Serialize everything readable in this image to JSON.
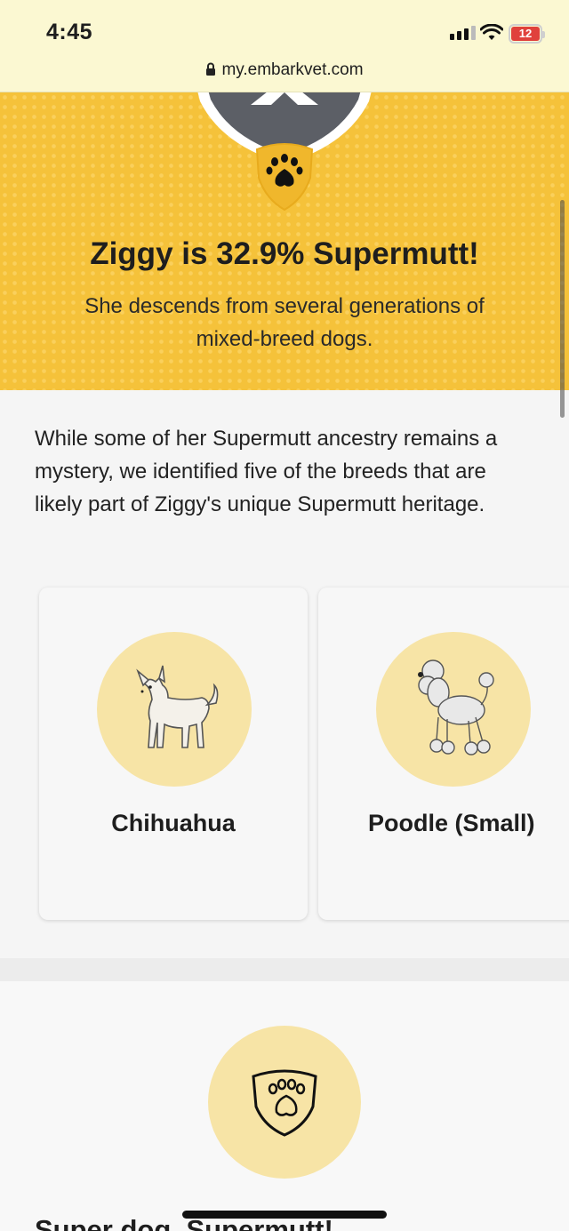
{
  "status_bar": {
    "time": "4:45",
    "battery": "12"
  },
  "browser": {
    "url": "my.embarkvet.com"
  },
  "hero": {
    "title": "Ziggy is 32.9% Supermutt!",
    "subtitle": "She descends from several generations of mixed-breed dogs."
  },
  "intro": "While some of her Supermutt ancestry remains a mystery, we identified five of the breeds that are likely part of Ziggy's unique Supermutt heritage.",
  "breeds": [
    {
      "name": "Chihuahua",
      "icon": "chihuahua-illustration"
    },
    {
      "name": "Poodle (Small)",
      "icon": "poodle-illustration"
    }
  ],
  "supermutt_section": {
    "title": "Super dog. Supermutt!",
    "icon": "paw-shield-icon"
  },
  "colors": {
    "hero_bg": "#f5c23a",
    "accent_circle": "#f7e4a6",
    "topbar_bg": "#fbf8d2"
  }
}
